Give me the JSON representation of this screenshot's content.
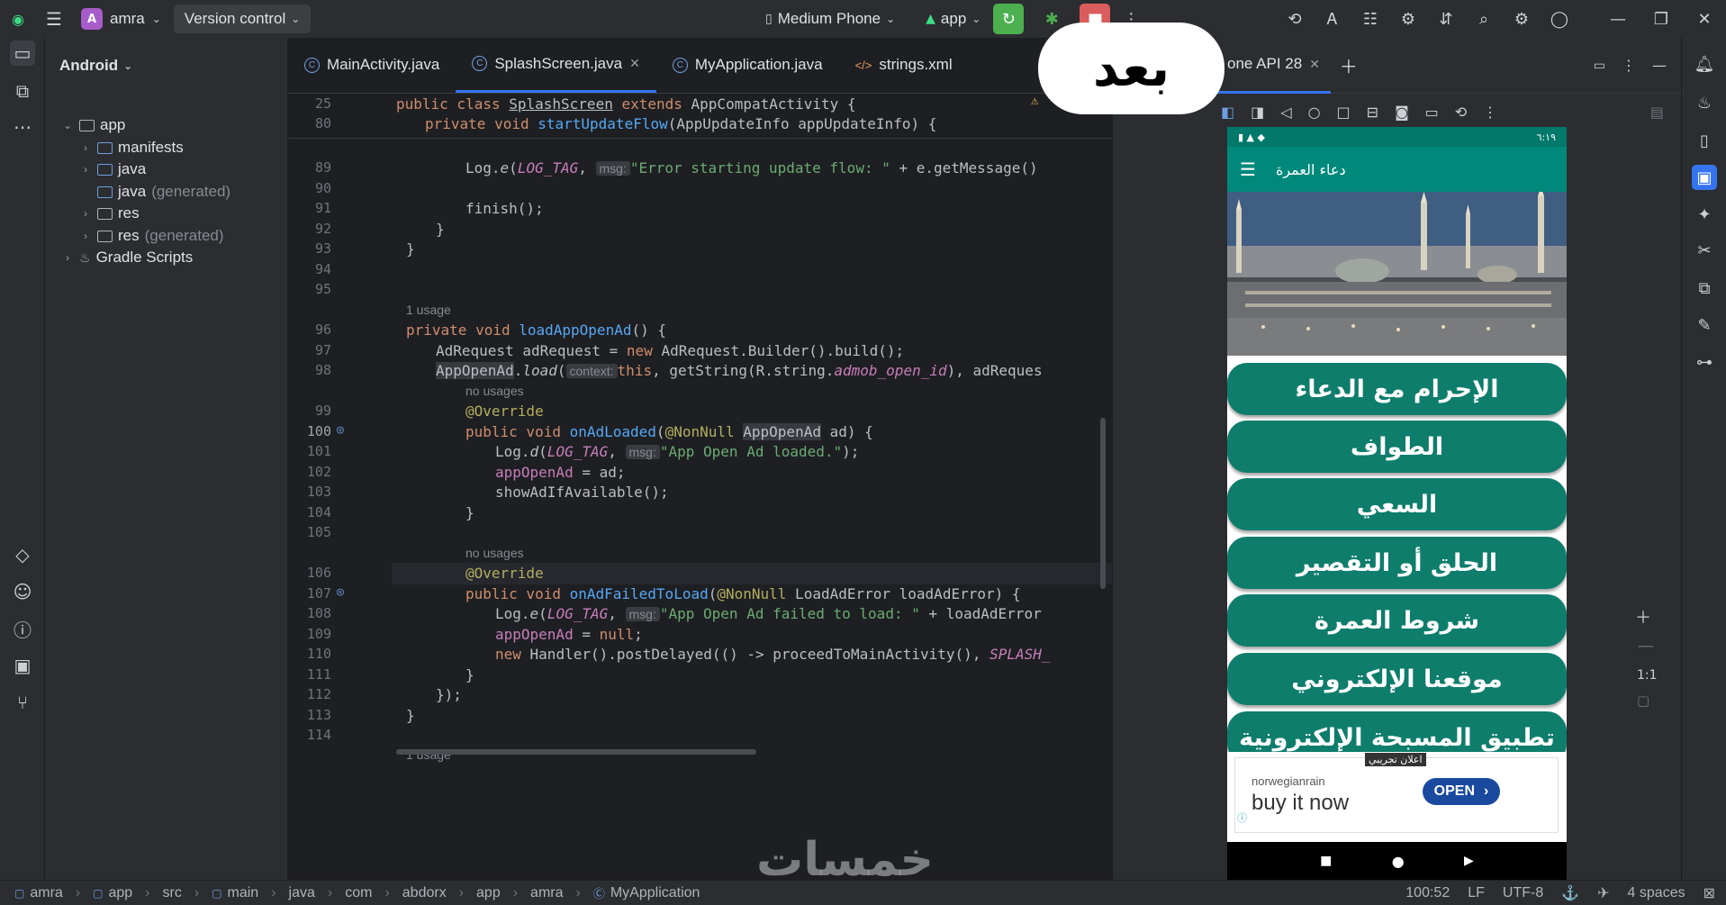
{
  "titlebar": {
    "project_initial": "A",
    "project_name": "amra",
    "vcs_label": "Version control",
    "device": "Medium Phone",
    "run_config": "app"
  },
  "project_panel": {
    "view": "Android",
    "tree": [
      {
        "label": "app",
        "suffix": ""
      },
      {
        "label": "manifests",
        "suffix": ""
      },
      {
        "label": "java",
        "suffix": ""
      },
      {
        "label": "java",
        "suffix": "(generated)"
      },
      {
        "label": "res",
        "suffix": ""
      },
      {
        "label": "res",
        "suffix": "(generated)"
      },
      {
        "label": "Gradle Scripts",
        "suffix": ""
      }
    ]
  },
  "editor": {
    "tabs": [
      {
        "label": "MainActivity.java"
      },
      {
        "label": "SplashScreen.java"
      },
      {
        "label": "MyApplication.java"
      },
      {
        "label": "strings.xml"
      }
    ],
    "sticky": [
      {
        "num": "25",
        "text": "public class SplashScreen extends AppCompatActivity {"
      },
      {
        "num": "80",
        "text": "private void startUpdateFlow(AppUpdateInfo appUpdateInfo) {"
      }
    ],
    "lines": [
      {
        "num": "89"
      },
      {
        "num": "90"
      },
      {
        "num": "91"
      },
      {
        "num": "92"
      },
      {
        "num": "93"
      },
      {
        "num": "94"
      },
      {
        "num": "95"
      },
      {
        "num": "96"
      },
      {
        "num": "97"
      },
      {
        "num": "98"
      },
      {
        "num": "99"
      },
      {
        "num": "100"
      },
      {
        "num": "101"
      },
      {
        "num": "102"
      },
      {
        "num": "103"
      },
      {
        "num": "104"
      },
      {
        "num": "105"
      },
      {
        "num": "106"
      },
      {
        "num": "107"
      },
      {
        "num": "108"
      },
      {
        "num": "109"
      },
      {
        "num": "110"
      },
      {
        "num": "111"
      },
      {
        "num": "112"
      },
      {
        "num": "113"
      },
      {
        "num": "114"
      }
    ],
    "hints": {
      "usage_1": "1 usage",
      "no_usages_a": "no usages",
      "no_usages_b": "no usages",
      "usage_bottom": "1 usage"
    },
    "code": {
      "l89_a": "Log.",
      "l89_fn": "e",
      "l89_tag": "LOG_TAG",
      "l89_msg": "msg:",
      "l89_str": "\"Error starting update flow: \"",
      "l89_rest": " + e.getMessage()",
      "l91": "finish();",
      "l92": "}",
      "l93": "}",
      "l96_kw": "private void ",
      "l96_fn": "loadAppOpenAd",
      "l96_rest": "() {",
      "l97_a": "AdRequest adRequest = ",
      "l97_kw": "new",
      "l97_rest": " AdRequest.Builder().build();",
      "l98_a": "AppOpenAd",
      "l98_b": ".",
      "l98_fn": "load",
      "l98_c": "(",
      "l98_ctx": "context:",
      "l98_kw": "this",
      "l98_d": ", getString(R.string.",
      "l98_res": "admob_open_id",
      "l98_e": "), adReques",
      "l99": "@Override",
      "l100_kw": "public void ",
      "l100_fn": "onAdLoaded",
      "l100_a": "(",
      "l100_an": "@NonNull",
      "l100_b": " ",
      "l100_hl": "AppOpenAd",
      "l100_c": " ad) {",
      "l101_a": "Log.",
      "l101_fn": "d",
      "l101_tag": "LOG_TAG",
      "l101_msg": "msg:",
      "l101_str": "\"App Open Ad loaded.\"",
      "l101_b": ");",
      "l102_f": "appOpenAd",
      "l102_b": " = ad;",
      "l103": "showAdIfAvailable();",
      "l104": "}",
      "l106": "@Override",
      "l107_kw": "public void ",
      "l107_fn": "onAdFailedToLoad",
      "l107_a": "(",
      "l107_an": "@NonNull",
      "l107_b": " LoadAdError loadAdError) {",
      "l108_a": "Log.",
      "l108_fn": "e",
      "l108_tag": "LOG_TAG",
      "l108_msg": "msg:",
      "l108_str": "\"App Open Ad failed to load: \"",
      "l108_b": " + loadAdError",
      "l109_f": "appOpenAd",
      "l109_b": " = ",
      "l109_kw": "null",
      "l109_c": ";",
      "l110_kw": "new",
      "l110_a": " Handler().postDelayed(() -> proceedToMainActivity(), ",
      "l110_c": "SPLASH_",
      "l111": "}",
      "l112": "});",
      "l113": "}"
    }
  },
  "emulator": {
    "tab_label": "one API 28",
    "status_time": "٦:١٩",
    "app_title": "دعاء العمرة",
    "menu": [
      "الإحرام مع الدعاء",
      "الطواف",
      "السعي",
      "الحلق أو التقصير",
      "شروط العمرة",
      "موقعنا الإلكتروني",
      "تطبيق المسبحة الإلكترونية"
    ],
    "ad": {
      "badge": "اعلان تجريبي",
      "advertiser": "norwegianrain",
      "headline": "buy it now",
      "cta": "OPEN"
    },
    "zoom_label": "1:1"
  },
  "statusbar": {
    "crumbs": [
      "amra",
      "app",
      "src",
      "main",
      "java",
      "com",
      "abdorx",
      "app",
      "amra",
      "MyApplication"
    ],
    "position": "100:52",
    "line_sep": "LF",
    "encoding": "UTF-8",
    "indent": "4 spaces"
  },
  "overlay_text": "بعد",
  "watermark": "خمسات",
  "colors": {
    "accent": "#3574f0",
    "teal_button": "#0e7d6c",
    "run_green": "#4caf50",
    "stop_red": "#db5c5c"
  }
}
